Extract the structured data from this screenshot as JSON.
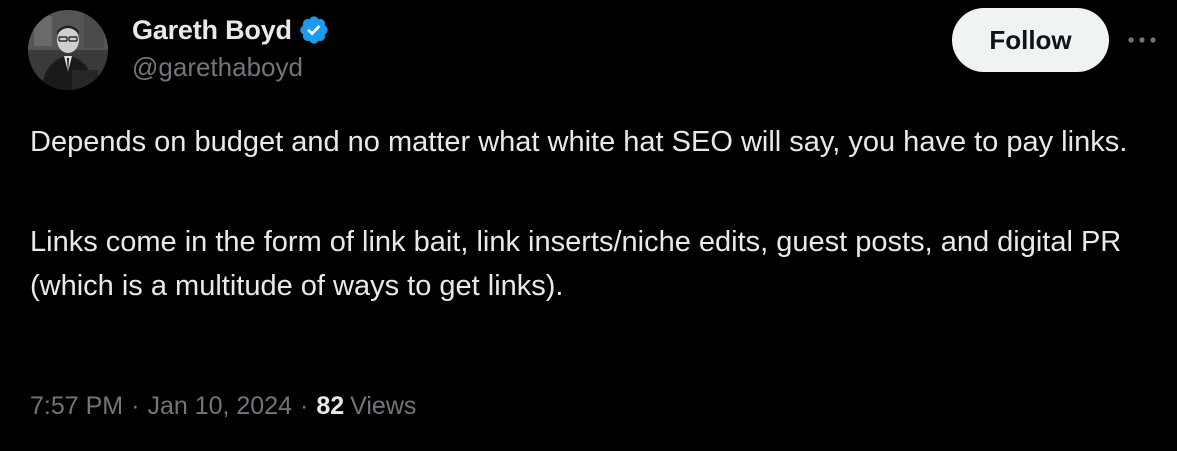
{
  "author": {
    "display_name": "Gareth Boyd",
    "handle": "@garethaboyd",
    "avatar_icon": "profile-photo",
    "verified_icon": "verified-badge-icon",
    "verified_color": "#1d9bf0"
  },
  "actions": {
    "follow_label": "Follow",
    "more_icon": "more-horizontal-icon"
  },
  "tweet": {
    "paragraphs": [
      "Depends on budget and no matter what white hat SEO will say, you have to pay links.",
      "Links come in the form of link bait, link inserts/niche edits, guest posts, and digital PR (which is a multitude of ways to get links)."
    ]
  },
  "meta": {
    "time": "7:57 PM",
    "separator": "·",
    "date": "Jan 10, 2024",
    "views_count": "82",
    "views_label": "Views"
  },
  "colors": {
    "background": "#000000",
    "text_primary": "#e7e9ea",
    "text_secondary": "#71767b",
    "follow_bg": "#eff3f4",
    "follow_text": "#0f1419"
  }
}
